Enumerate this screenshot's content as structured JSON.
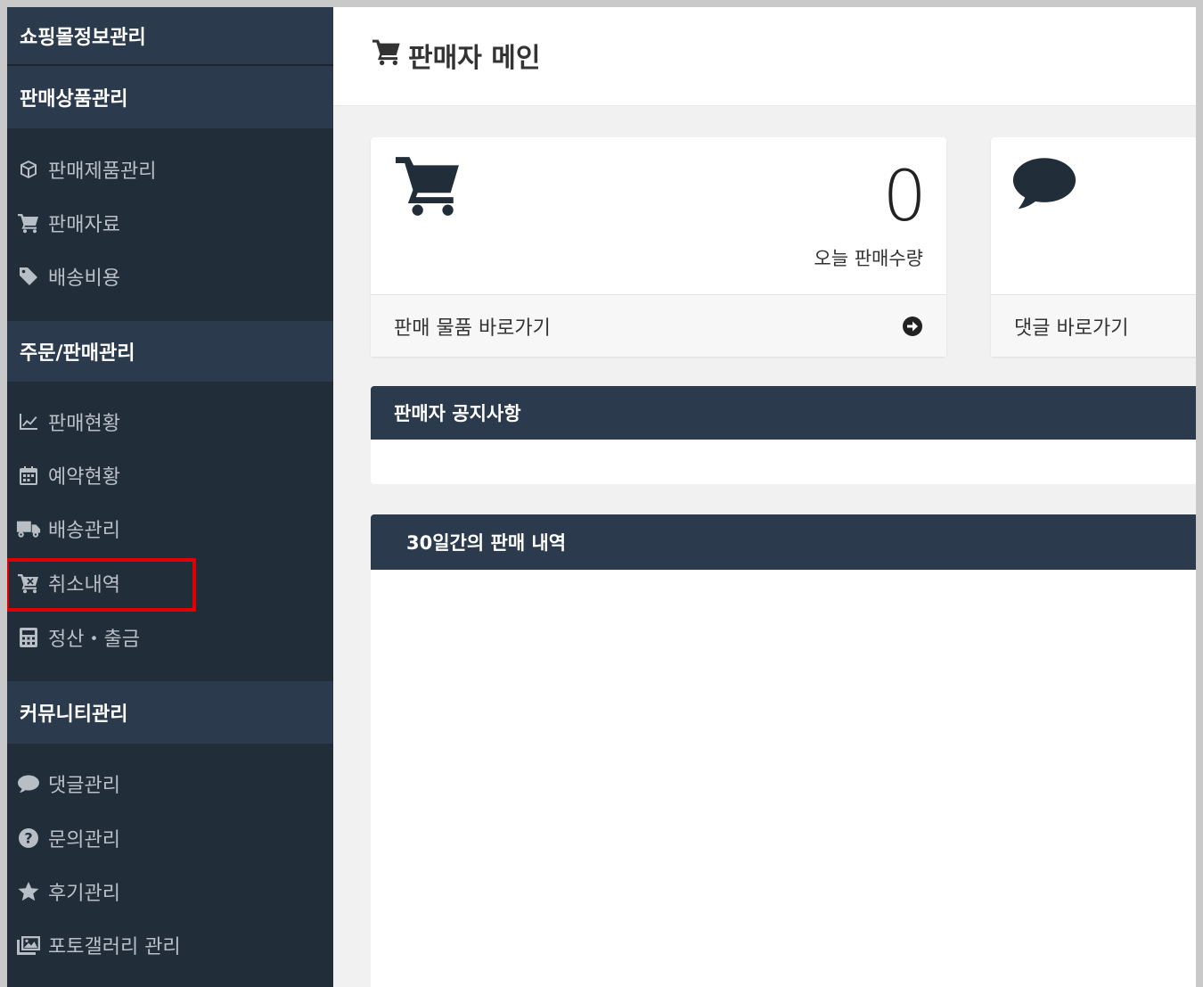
{
  "sidebar": {
    "sections": {
      "shop_info": "쇼핑몰정보관리",
      "products": "판매상품관리",
      "orders": "주문/판매관리",
      "community": "커뮤니티관리"
    },
    "product_items": [
      {
        "label": "판매제품관리",
        "icon": "cube-icon"
      },
      {
        "label": "판매자료",
        "icon": "cart-icon"
      },
      {
        "label": "배송비용",
        "icon": "tag-icon"
      }
    ],
    "order_items": [
      {
        "label": "판매현황",
        "icon": "line-chart-icon"
      },
      {
        "label": "예약현황",
        "icon": "calendar-icon"
      },
      {
        "label": "배송관리",
        "icon": "truck-icon"
      },
      {
        "label": "취소내역",
        "icon": "cart-cancel-icon"
      },
      {
        "label": "정산・출금",
        "icon": "calculator-icon"
      }
    ],
    "community_items": [
      {
        "label": "댓글관리",
        "icon": "comment-icon"
      },
      {
        "label": "문의관리",
        "icon": "question-icon"
      },
      {
        "label": "후기관리",
        "icon": "star-icon"
      },
      {
        "label": "포토갤러리 관리",
        "icon": "photo-icon"
      }
    ]
  },
  "main": {
    "title": "판매자 메인",
    "sales_card": {
      "count": "0",
      "count_label": "오늘 판매수량",
      "link_label": "판매 물품 바로가기"
    },
    "comment_card": {
      "link_label": "댓글 바로가기"
    },
    "notice_panel": {
      "title": "판매자 공지사항"
    },
    "history_panel": {
      "title": "30일간의 판매 내역"
    }
  },
  "colors": {
    "sidebar_bg": "#222d3a",
    "header_bg": "#2b3a4c",
    "highlight": "#e10000"
  }
}
